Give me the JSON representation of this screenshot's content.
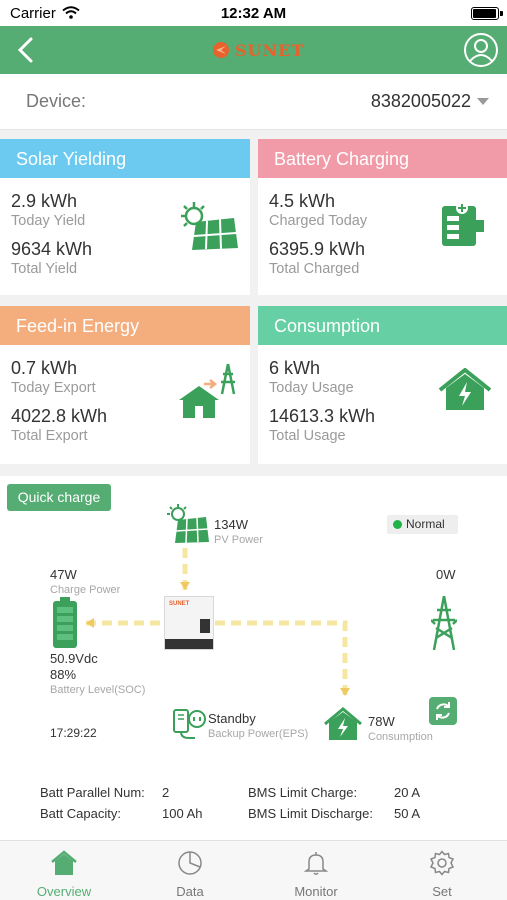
{
  "status_bar": {
    "carrier": "Carrier",
    "time": "12:32 AM"
  },
  "header": {
    "logo_text": "SUNET",
    "back_icon": "chevron-left-icon",
    "user_icon": "user-circle-icon",
    "bg_color": "#55ad73"
  },
  "device": {
    "label": "Device:",
    "value": "8382005022"
  },
  "cards": {
    "solar": {
      "title": "Solar Yielding",
      "color": "#6ccaf0",
      "today_value": "2.9 kWh",
      "today_label": "Today Yield",
      "total_value": "9634 kWh",
      "total_label": "Total Yield",
      "icon": "solar-panel-icon"
    },
    "battery": {
      "title": "Battery Charging",
      "color": "#f19ba9",
      "today_value": "4.5 kWh",
      "today_label": "Charged Today",
      "total_value": "6395.9 kWh",
      "total_label": "Total Charged",
      "icon": "battery-charging-icon"
    },
    "feedin": {
      "title": "Feed-in Energy",
      "color": "#f4ae7e",
      "today_value": "0.7 kWh",
      "today_label": "Today Export",
      "total_value": "4022.8 kWh",
      "total_label": "Total Export",
      "icon": "house-grid-export-icon"
    },
    "consumption": {
      "title": "Consumption",
      "color": "#66cfa3",
      "today_value": "6 kWh",
      "today_label": "Today Usage",
      "total_value": "14613.3 kWh",
      "total_label": "Total Usage",
      "icon": "house-lightning-icon"
    }
  },
  "flow": {
    "quick_charge": "Quick charge",
    "status": "Normal",
    "pv_value": "134W",
    "pv_label": "PV Power",
    "charge_value": "47W",
    "charge_label": "Charge Power",
    "grid_value": "0W",
    "battery_voltage": "50.9Vdc",
    "battery_soc": "88%",
    "battery_label": "Battery Level(SOC)",
    "time": "17:29:22",
    "eps_value": "Standby",
    "eps_label": "Backup Power(EPS)",
    "consumption_value": "78W",
    "consumption_label": "Consumption",
    "inverter_brand": "SUNET"
  },
  "info": {
    "parallel_label": "Batt Parallel Num:",
    "parallel_value": "2",
    "capacity_label": "Batt Capacity:",
    "capacity_value": "100 Ah",
    "bms_charge_label": "BMS Limit Charge:",
    "bms_charge_value": "20 A",
    "bms_discharge_label": "BMS Limit Discharge:",
    "bms_discharge_value": "50 A"
  },
  "tabs": [
    {
      "label": "Overview",
      "icon": "home-icon",
      "active": true
    },
    {
      "label": "Data",
      "icon": "pie-chart-icon",
      "active": false
    },
    {
      "label": "Monitor",
      "icon": "bell-icon",
      "active": false
    },
    {
      "label": "Set",
      "icon": "gear-icon",
      "active": false
    }
  ]
}
